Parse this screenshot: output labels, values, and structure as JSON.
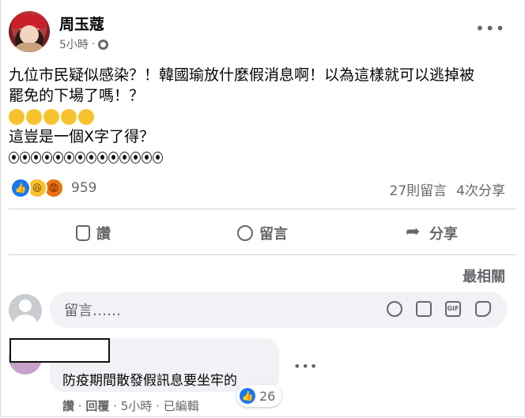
{
  "post": {
    "author": "周玉蔻",
    "time": "5小時",
    "separator": "·",
    "more": "•••",
    "lines": [
      "九位市民疑似感染？！韓國瑜放什麼假消息啊！以為這樣就可以逃掉被",
      "罷免的下場了嗎！？",
      "這豈是一個X字了得？"
    ],
    "emojis": [
      "astonished-face",
      "grinning-face",
      "grinning-face",
      "winking-tongue-face",
      "hand-over-mouth-face"
    ],
    "eyes_count": 14
  },
  "reactions": {
    "types": [
      "like",
      "haha",
      "angry"
    ],
    "count": "959",
    "comments": "27則留言",
    "shares": "4次分享"
  },
  "actions": {
    "like": "讚",
    "comment": "留言",
    "share": "分享"
  },
  "comments_section": {
    "sort_label": "最相關",
    "composer_placeholder": "留言……",
    "composer_icons": [
      "smile-icon",
      "camera-icon",
      "gif-icon",
      "sticker-icon"
    ],
    "gif_label": "GIF"
  },
  "comment": {
    "text": "防疫期間散發假訊息要坐牢的",
    "like_count": "26",
    "like_label": "讚",
    "reply_label": "回覆",
    "time": "5小時",
    "edited": "已編輯",
    "dot": "·",
    "more": "•••"
  },
  "colors": {
    "accent": "#1877f2",
    "secondary_text": "#65676b",
    "bubble_bg": "#f0f2f5"
  }
}
